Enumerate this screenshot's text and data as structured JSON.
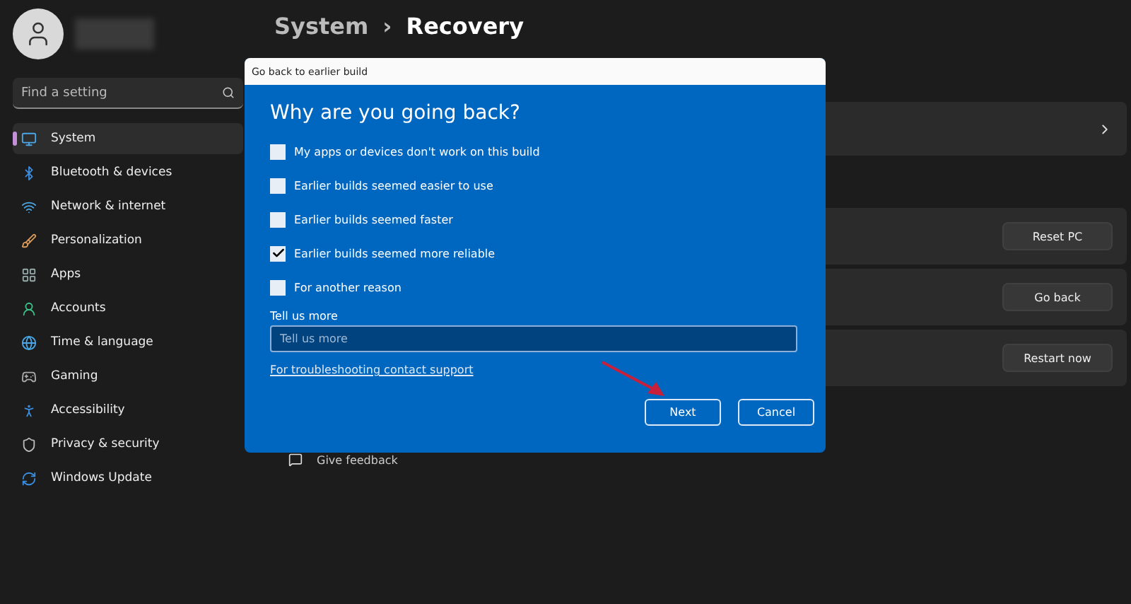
{
  "sidebar": {
    "search": {
      "placeholder": "Find a setting"
    },
    "items": [
      {
        "label": "System",
        "kind": "system",
        "selected": true
      },
      {
        "label": "Bluetooth & devices",
        "kind": "bluetooth",
        "selected": false
      },
      {
        "label": "Network & internet",
        "kind": "wifi",
        "selected": false
      },
      {
        "label": "Personalization",
        "kind": "brush",
        "selected": false
      },
      {
        "label": "Apps",
        "kind": "apps",
        "selected": false
      },
      {
        "label": "Accounts",
        "kind": "person",
        "selected": false
      },
      {
        "label": "Time & language",
        "kind": "globe",
        "selected": false
      },
      {
        "label": "Gaming",
        "kind": "gamepad",
        "selected": false
      },
      {
        "label": "Accessibility",
        "kind": "accessibility",
        "selected": false
      },
      {
        "label": "Privacy & security",
        "kind": "shield",
        "selected": false
      },
      {
        "label": "Windows Update",
        "kind": "update",
        "selected": false
      }
    ]
  },
  "breadcrumb": {
    "parent": "System",
    "separator": "›",
    "current": "Recovery"
  },
  "cards": [
    {
      "kind": "link"
    },
    {
      "kind": "gap"
    },
    {
      "kind": "button",
      "button": "Reset PC"
    },
    {
      "kind": "button",
      "button": "Go back"
    },
    {
      "kind": "button",
      "button": "Restart now"
    }
  ],
  "feedback": {
    "label": "Give feedback"
  },
  "dialog": {
    "title": "Go back to earlier build",
    "heading": "Why are you going back?",
    "options": [
      {
        "label": "My apps or devices don't work on this build",
        "checked": false
      },
      {
        "label": "Earlier builds seemed easier to use",
        "checked": false
      },
      {
        "label": "Earlier builds seemed faster",
        "checked": false
      },
      {
        "label": "Earlier builds seemed more reliable",
        "checked": true
      },
      {
        "label": "For another reason",
        "checked": false
      }
    ],
    "field": {
      "label": "Tell us more",
      "placeholder": "Tell us more"
    },
    "link": "For troubleshooting contact support",
    "buttons": [
      "Next",
      "Cancel"
    ]
  }
}
